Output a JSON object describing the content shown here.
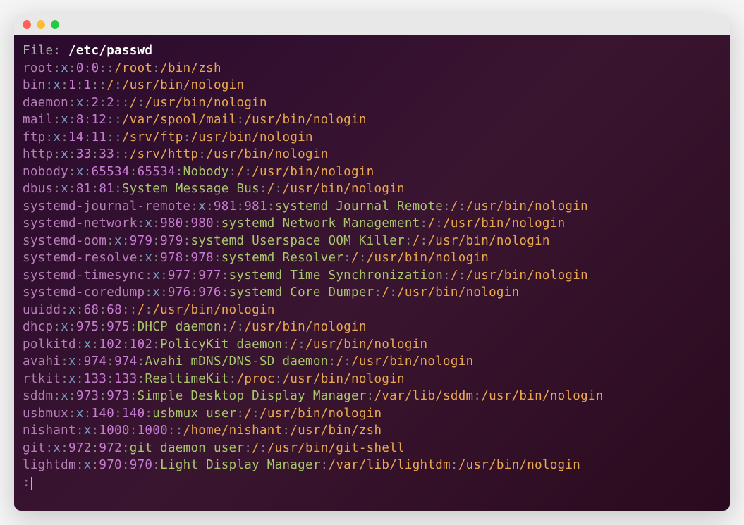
{
  "header": {
    "label": "File: ",
    "path": "/etc/passwd"
  },
  "entries": [
    {
      "user": "root",
      "pw": "x",
      "uid": "0",
      "gid": "0",
      "gecos": "",
      "home": "/root",
      "shell": "/bin/zsh"
    },
    {
      "user": "bin",
      "pw": "x",
      "uid": "1",
      "gid": "1",
      "gecos": "",
      "home": "/",
      "shell": "/usr/bin/nologin"
    },
    {
      "user": "daemon",
      "pw": "x",
      "uid": "2",
      "gid": "2",
      "gecos": "",
      "home": "/",
      "shell": "/usr/bin/nologin"
    },
    {
      "user": "mail",
      "pw": "x",
      "uid": "8",
      "gid": "12",
      "gecos": "",
      "home": "/var/spool/mail",
      "shell": "/usr/bin/nologin"
    },
    {
      "user": "ftp",
      "pw": "x",
      "uid": "14",
      "gid": "11",
      "gecos": "",
      "home": "/srv/ftp",
      "shell": "/usr/bin/nologin"
    },
    {
      "user": "http",
      "pw": "x",
      "uid": "33",
      "gid": "33",
      "gecos": "",
      "home": "/srv/http",
      "shell": "/usr/bin/nologin"
    },
    {
      "user": "nobody",
      "pw": "x",
      "uid": "65534",
      "gid": "65534",
      "gecos": "Nobody",
      "home": "/",
      "shell": "/usr/bin/nologin"
    },
    {
      "user": "dbus",
      "pw": "x",
      "uid": "81",
      "gid": "81",
      "gecos": "System Message Bus",
      "home": "/",
      "shell": "/usr/bin/nologin"
    },
    {
      "user": "systemd-journal-remote",
      "pw": "x",
      "uid": "981",
      "gid": "981",
      "gecos": "systemd Journal Remote",
      "home": "/",
      "shell": "/usr/bin/nologin"
    },
    {
      "user": "systemd-network",
      "pw": "x",
      "uid": "980",
      "gid": "980",
      "gecos": "systemd Network Management",
      "home": "/",
      "shell": "/usr/bin/nologin"
    },
    {
      "user": "systemd-oom",
      "pw": "x",
      "uid": "979",
      "gid": "979",
      "gecos": "systemd Userspace OOM Killer",
      "home": "/",
      "shell": "/usr/bin/nologin"
    },
    {
      "user": "systemd-resolve",
      "pw": "x",
      "uid": "978",
      "gid": "978",
      "gecos": "systemd Resolver",
      "home": "/",
      "shell": "/usr/bin/nologin"
    },
    {
      "user": "systemd-timesync",
      "pw": "x",
      "uid": "977",
      "gid": "977",
      "gecos": "systemd Time Synchronization",
      "home": "/",
      "shell": "/usr/bin/nologin"
    },
    {
      "user": "systemd-coredump",
      "pw": "x",
      "uid": "976",
      "gid": "976",
      "gecos": "systemd Core Dumper",
      "home": "/",
      "shell": "/usr/bin/nologin"
    },
    {
      "user": "uuidd",
      "pw": "x",
      "uid": "68",
      "gid": "68",
      "gecos": "",
      "home": "/",
      "shell": "/usr/bin/nologin"
    },
    {
      "user": "dhcp",
      "pw": "x",
      "uid": "975",
      "gid": "975",
      "gecos": "DHCP daemon",
      "home": "/",
      "shell": "/usr/bin/nologin"
    },
    {
      "user": "polkitd",
      "pw": "x",
      "uid": "102",
      "gid": "102",
      "gecos": "PolicyKit daemon",
      "home": "/",
      "shell": "/usr/bin/nologin"
    },
    {
      "user": "avahi",
      "pw": "x",
      "uid": "974",
      "gid": "974",
      "gecos": "Avahi mDNS/DNS-SD daemon",
      "home": "/",
      "shell": "/usr/bin/nologin"
    },
    {
      "user": "rtkit",
      "pw": "x",
      "uid": "133",
      "gid": "133",
      "gecos": "RealtimeKit",
      "home": "/proc",
      "shell": "/usr/bin/nologin"
    },
    {
      "user": "sddm",
      "pw": "x",
      "uid": "973",
      "gid": "973",
      "gecos": "Simple Desktop Display Manager",
      "home": "/var/lib/sddm",
      "shell": "/usr/bin/nologin"
    },
    {
      "user": "usbmux",
      "pw": "x",
      "uid": "140",
      "gid": "140",
      "gecos": "usbmux user",
      "home": "/",
      "shell": "/usr/bin/nologin"
    },
    {
      "user": "nishant",
      "pw": "x",
      "uid": "1000",
      "gid": "1000",
      "gecos": "",
      "home": "/home/nishant",
      "shell": "/usr/bin/zsh"
    },
    {
      "user": "git",
      "pw": "x",
      "uid": "972",
      "gid": "972",
      "gecos": "git daemon user",
      "home": "/",
      "shell": "/usr/bin/git-shell"
    },
    {
      "user": "lightdm",
      "pw": "x",
      "uid": "970",
      "gid": "970",
      "gecos": "Light Display Manager",
      "home": "/var/lib/lightdm",
      "shell": "/usr/bin/nologin"
    }
  ],
  "prompt": ":"
}
